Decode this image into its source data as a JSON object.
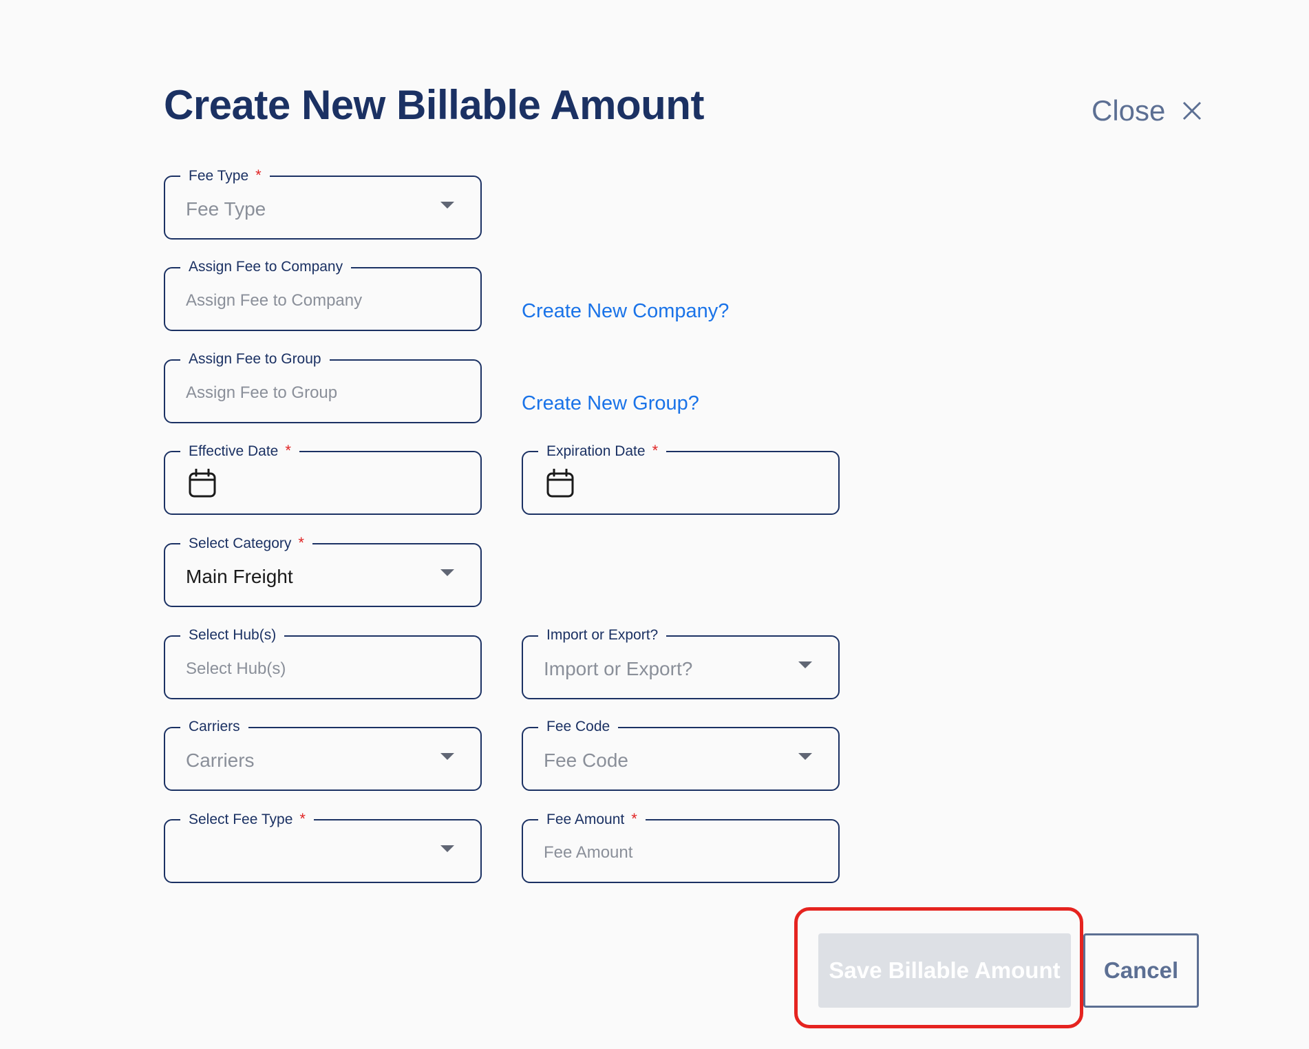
{
  "dialog": {
    "title": "Create New Billable Amount",
    "close_label": "Close"
  },
  "fields": {
    "fee_type": {
      "label": "Fee Type",
      "required": "*",
      "placeholder": "Fee Type"
    },
    "assign_company": {
      "label": "Assign Fee to Company",
      "placeholder": "Assign Fee to Company"
    },
    "assign_group": {
      "label": "Assign Fee to Group",
      "placeholder": "Assign Fee to Group"
    },
    "effective_date": {
      "label": "Effective Date",
      "required": "*"
    },
    "expiration_date": {
      "label": "Expiration Date",
      "required": "*"
    },
    "select_category": {
      "label": "Select Category",
      "required": "*",
      "value": "Main Freight"
    },
    "select_hubs": {
      "label": "Select Hub(s)",
      "placeholder": "Select Hub(s)"
    },
    "import_export": {
      "label": "Import or Export?",
      "placeholder": "Import or Export?"
    },
    "carriers": {
      "label": "Carriers",
      "placeholder": "Carriers"
    },
    "fee_code": {
      "label": "Fee Code",
      "placeholder": "Fee Code"
    },
    "select_fee_type": {
      "label": "Select Fee Type",
      "required": "*",
      "value": ""
    },
    "fee_amount": {
      "label": "Fee Amount",
      "required": "*",
      "placeholder": "Fee Amount"
    }
  },
  "links": {
    "create_company": "Create New Company?",
    "create_group": "Create New Group?"
  },
  "actions": {
    "save_label": "Save Billable Amount",
    "cancel_label": "Cancel"
  },
  "colors": {
    "primary": "#1b3163",
    "link": "#1a73e8",
    "required": "#e02424",
    "highlight": "#e5231f",
    "disabled": "#dde0e5"
  }
}
